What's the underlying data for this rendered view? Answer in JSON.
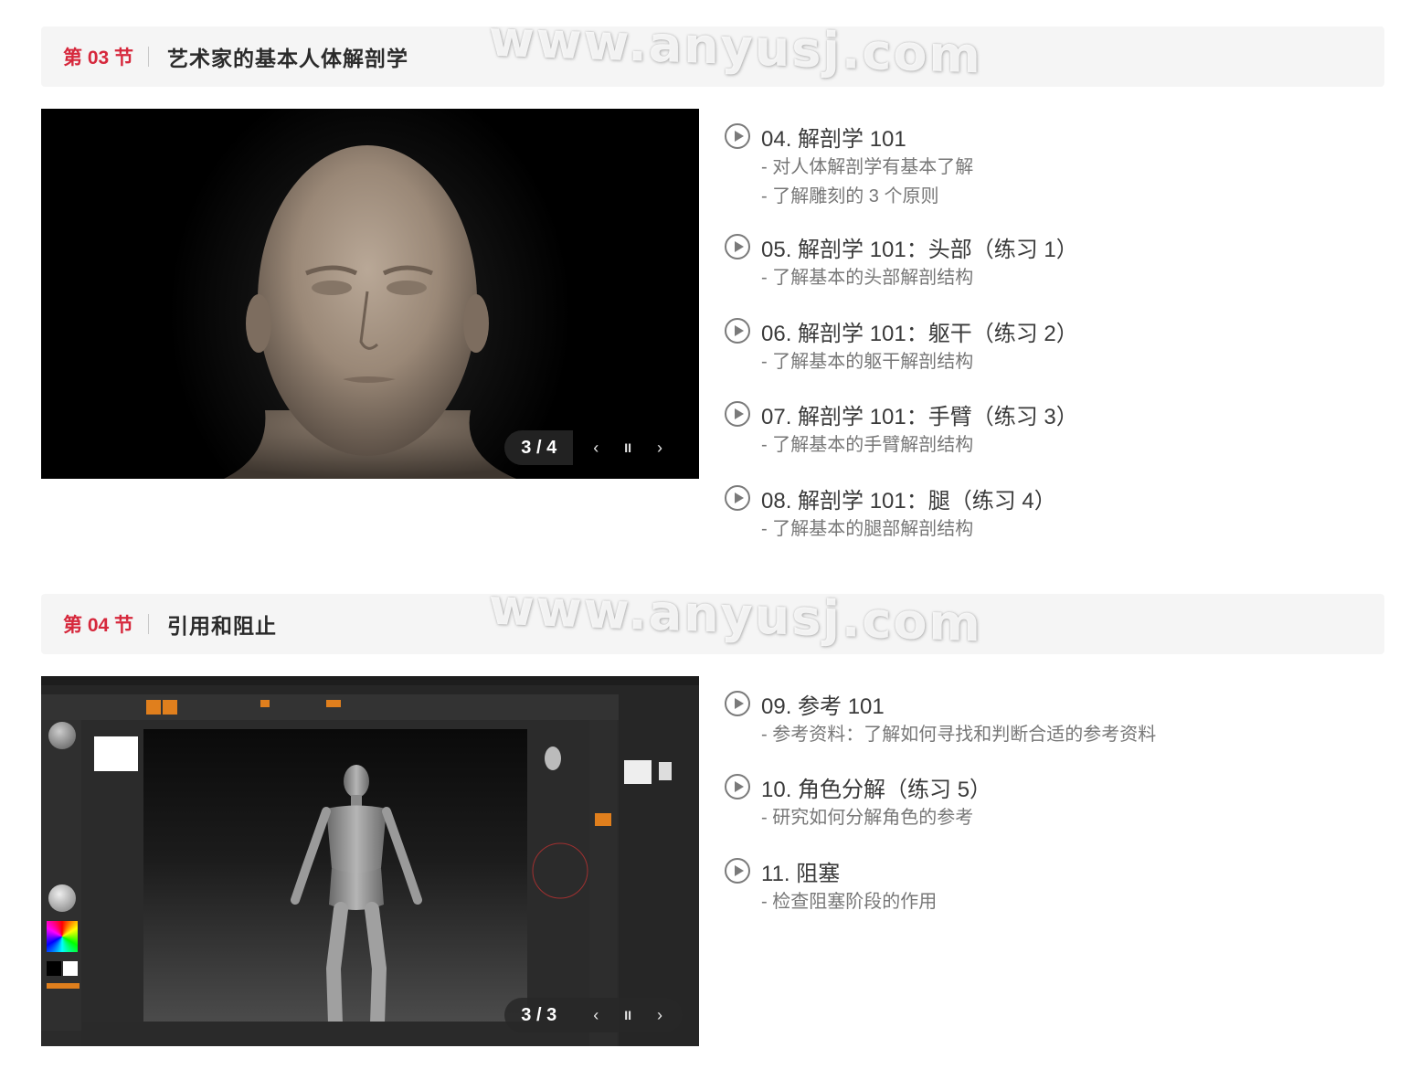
{
  "watermark": "www.anyusj.com",
  "sections": [
    {
      "num": "第 03 节",
      "title": "艺术家的基本人体解剖学",
      "slider": {
        "counter": "3 / 4",
        "prev": "‹",
        "pause": "II",
        "next": "›"
      },
      "lessons": [
        {
          "title": "04. 解剖学 101",
          "desc": [
            "- 对人体解剖学有基本了解",
            "- 了解雕刻的 3 个原则"
          ]
        },
        {
          "title": "05. 解剖学 101：头部（练习 1）",
          "desc": [
            "- 了解基本的头部解剖结构"
          ]
        },
        {
          "title": "06. 解剖学 101：躯干（练习 2）",
          "desc": [
            "- 了解基本的躯干解剖结构"
          ]
        },
        {
          "title": "07. 解剖学 101：手臂（练习 3）",
          "desc": [
            "- 了解基本的手臂解剖结构"
          ]
        },
        {
          "title": "08. 解剖学 101：腿（练习 4）",
          "desc": [
            "- 了解基本的腿部解剖结构"
          ]
        }
      ]
    },
    {
      "num": "第 04 节",
      "title": "引用和阻止",
      "slider": {
        "counter": "3 / 3",
        "prev": "‹",
        "pause": "II",
        "next": "›"
      },
      "lessons": [
        {
          "title": "09. 参考 101",
          "desc": [
            "- 参考资料：了解如何寻找和判断合适的参考资料"
          ]
        },
        {
          "title": "10. 角色分解（练习 5）",
          "desc": [
            "- 研究如何分解角色的参考"
          ]
        },
        {
          "title": "11. 阻塞",
          "desc": [
            "- 检查阻塞阶段的作用"
          ]
        }
      ]
    }
  ]
}
